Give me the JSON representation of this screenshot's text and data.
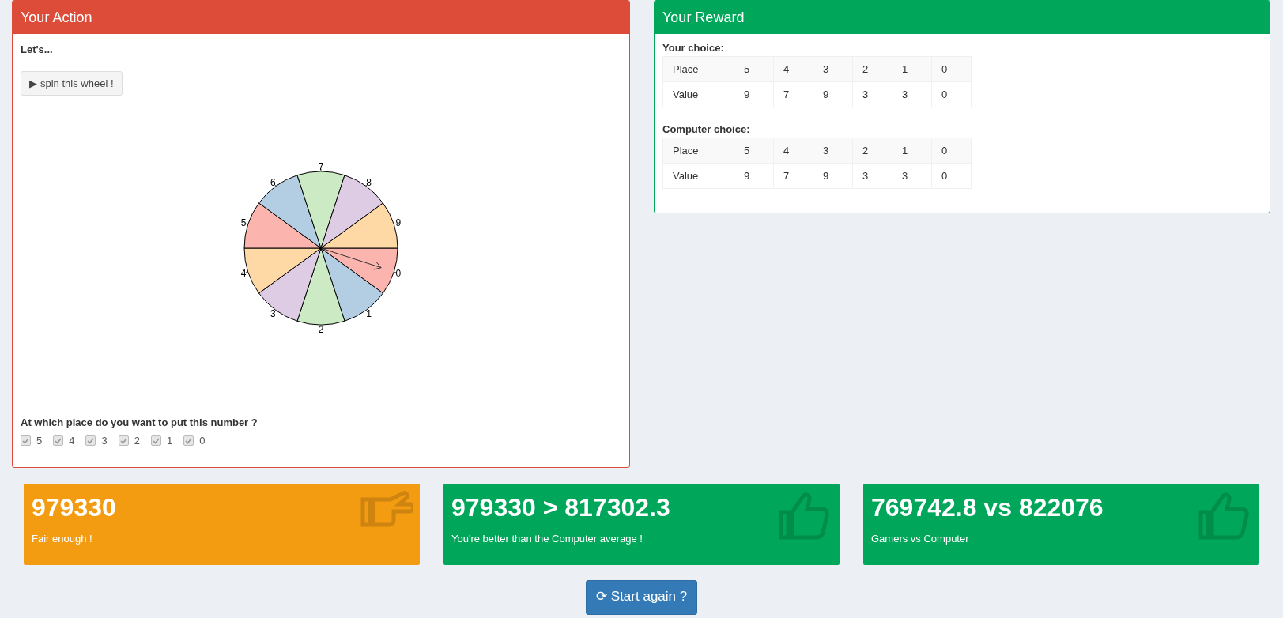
{
  "action_panel": {
    "title": "Your Action",
    "color": "#dd4b39",
    "intro": "Let's...",
    "spin_button": {
      "icon": "▶",
      "label": "spin this wheel !"
    },
    "wheel": {
      "slices": [
        {
          "label": "0",
          "color": "#fbb4ae",
          "selected": true
        },
        {
          "label": "1",
          "color": "#b3cde3",
          "selected": false
        },
        {
          "label": "2",
          "color": "#ccebc5",
          "selected": false
        },
        {
          "label": "3",
          "color": "#decbe4",
          "selected": false
        },
        {
          "label": "4",
          "color": "#fed9a6",
          "selected": false
        },
        {
          "label": "5",
          "color": "#fbb4ae",
          "selected": false
        },
        {
          "label": "6",
          "color": "#b3cde3",
          "selected": false
        },
        {
          "label": "7",
          "color": "#ccebc5",
          "selected": false
        },
        {
          "label": "8",
          "color": "#decbe4",
          "selected": false
        },
        {
          "label": "9",
          "color": "#fed9a6",
          "selected": false
        }
      ]
    },
    "question": "At which place do you want to put this number ?",
    "places": [
      {
        "label": "5",
        "checked": true,
        "disabled": true
      },
      {
        "label": "4",
        "checked": true,
        "disabled": true
      },
      {
        "label": "3",
        "checked": true,
        "disabled": true
      },
      {
        "label": "2",
        "checked": true,
        "disabled": true
      },
      {
        "label": "1",
        "checked": true,
        "disabled": true
      },
      {
        "label": "0",
        "checked": true,
        "disabled": true
      }
    ]
  },
  "reward_panel": {
    "title": "Your Reward",
    "color": "#00a65a",
    "tables": [
      {
        "caption": "Your choice:",
        "rows": [
          [
            "Place",
            "5",
            "4",
            "3",
            "2",
            "1",
            "0"
          ],
          [
            "Value",
            "9",
            "7",
            "9",
            "3",
            "3",
            "0"
          ]
        ]
      },
      {
        "caption": "Computer choice:",
        "rows": [
          [
            "Place",
            "5",
            "4",
            "3",
            "2",
            "1",
            "0"
          ],
          [
            "Value",
            "9",
            "7",
            "9",
            "3",
            "3",
            "0"
          ]
        ]
      }
    ]
  },
  "value_boxes": [
    {
      "kind": "sideways",
      "color": "#f39c12",
      "value": "979330",
      "subtitle": "Fair enough !"
    },
    {
      "kind": "up",
      "color": "#00a65a",
      "value": "979330 > 817302.3",
      "subtitle": "You're better than the Computer average !"
    },
    {
      "kind": "up",
      "color": "#00a65a",
      "value": "769742.8 vs 822076",
      "subtitle": "Gamers vs Computer"
    }
  ],
  "restart_button": {
    "icon": "⟳",
    "label": "Start again ?"
  }
}
